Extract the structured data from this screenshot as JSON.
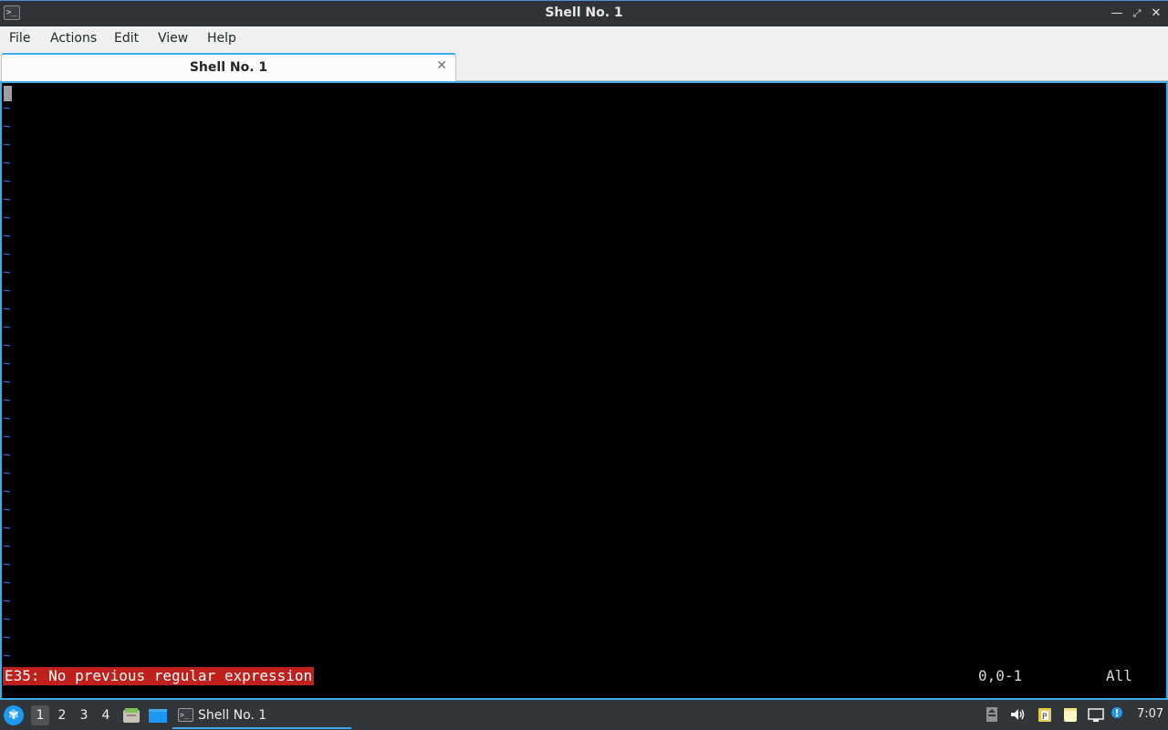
{
  "window": {
    "title": "Shell No. 1",
    "icon": "terminal-icon",
    "controls": {
      "minimize": "minimize-icon",
      "maximize": "maximize-icon",
      "close": "close-icon"
    }
  },
  "menu": {
    "items": [
      "File",
      "Actions",
      "Edit",
      "View",
      "Help"
    ]
  },
  "tabs": [
    {
      "label": "Shell No. 1",
      "close_icon": "close-tab-icon",
      "active": true
    }
  ],
  "terminal": {
    "tilde": "~",
    "error_message": "E35: No previous regular expression",
    "ruler": "0,0-1",
    "scroll_position": "All",
    "colors": {
      "background": "#000000",
      "tilde": "#3f6fe0",
      "error_bg": "#c0201c"
    }
  },
  "taskbar": {
    "start_icon": "start-menu-icon",
    "desktops": [
      "1",
      "2",
      "3",
      "4"
    ],
    "active_desktop": "1",
    "quick_launch": [
      "file-manager-icon",
      "show-desktop-icon"
    ],
    "task": {
      "label": "Shell No. 1",
      "icon": "terminal-icon"
    },
    "tray": [
      "removable-media-icon",
      "volume-icon",
      "clipboard-icon",
      "notes-icon",
      "network-icon",
      "notification-icon"
    ],
    "clock": "7:07"
  }
}
